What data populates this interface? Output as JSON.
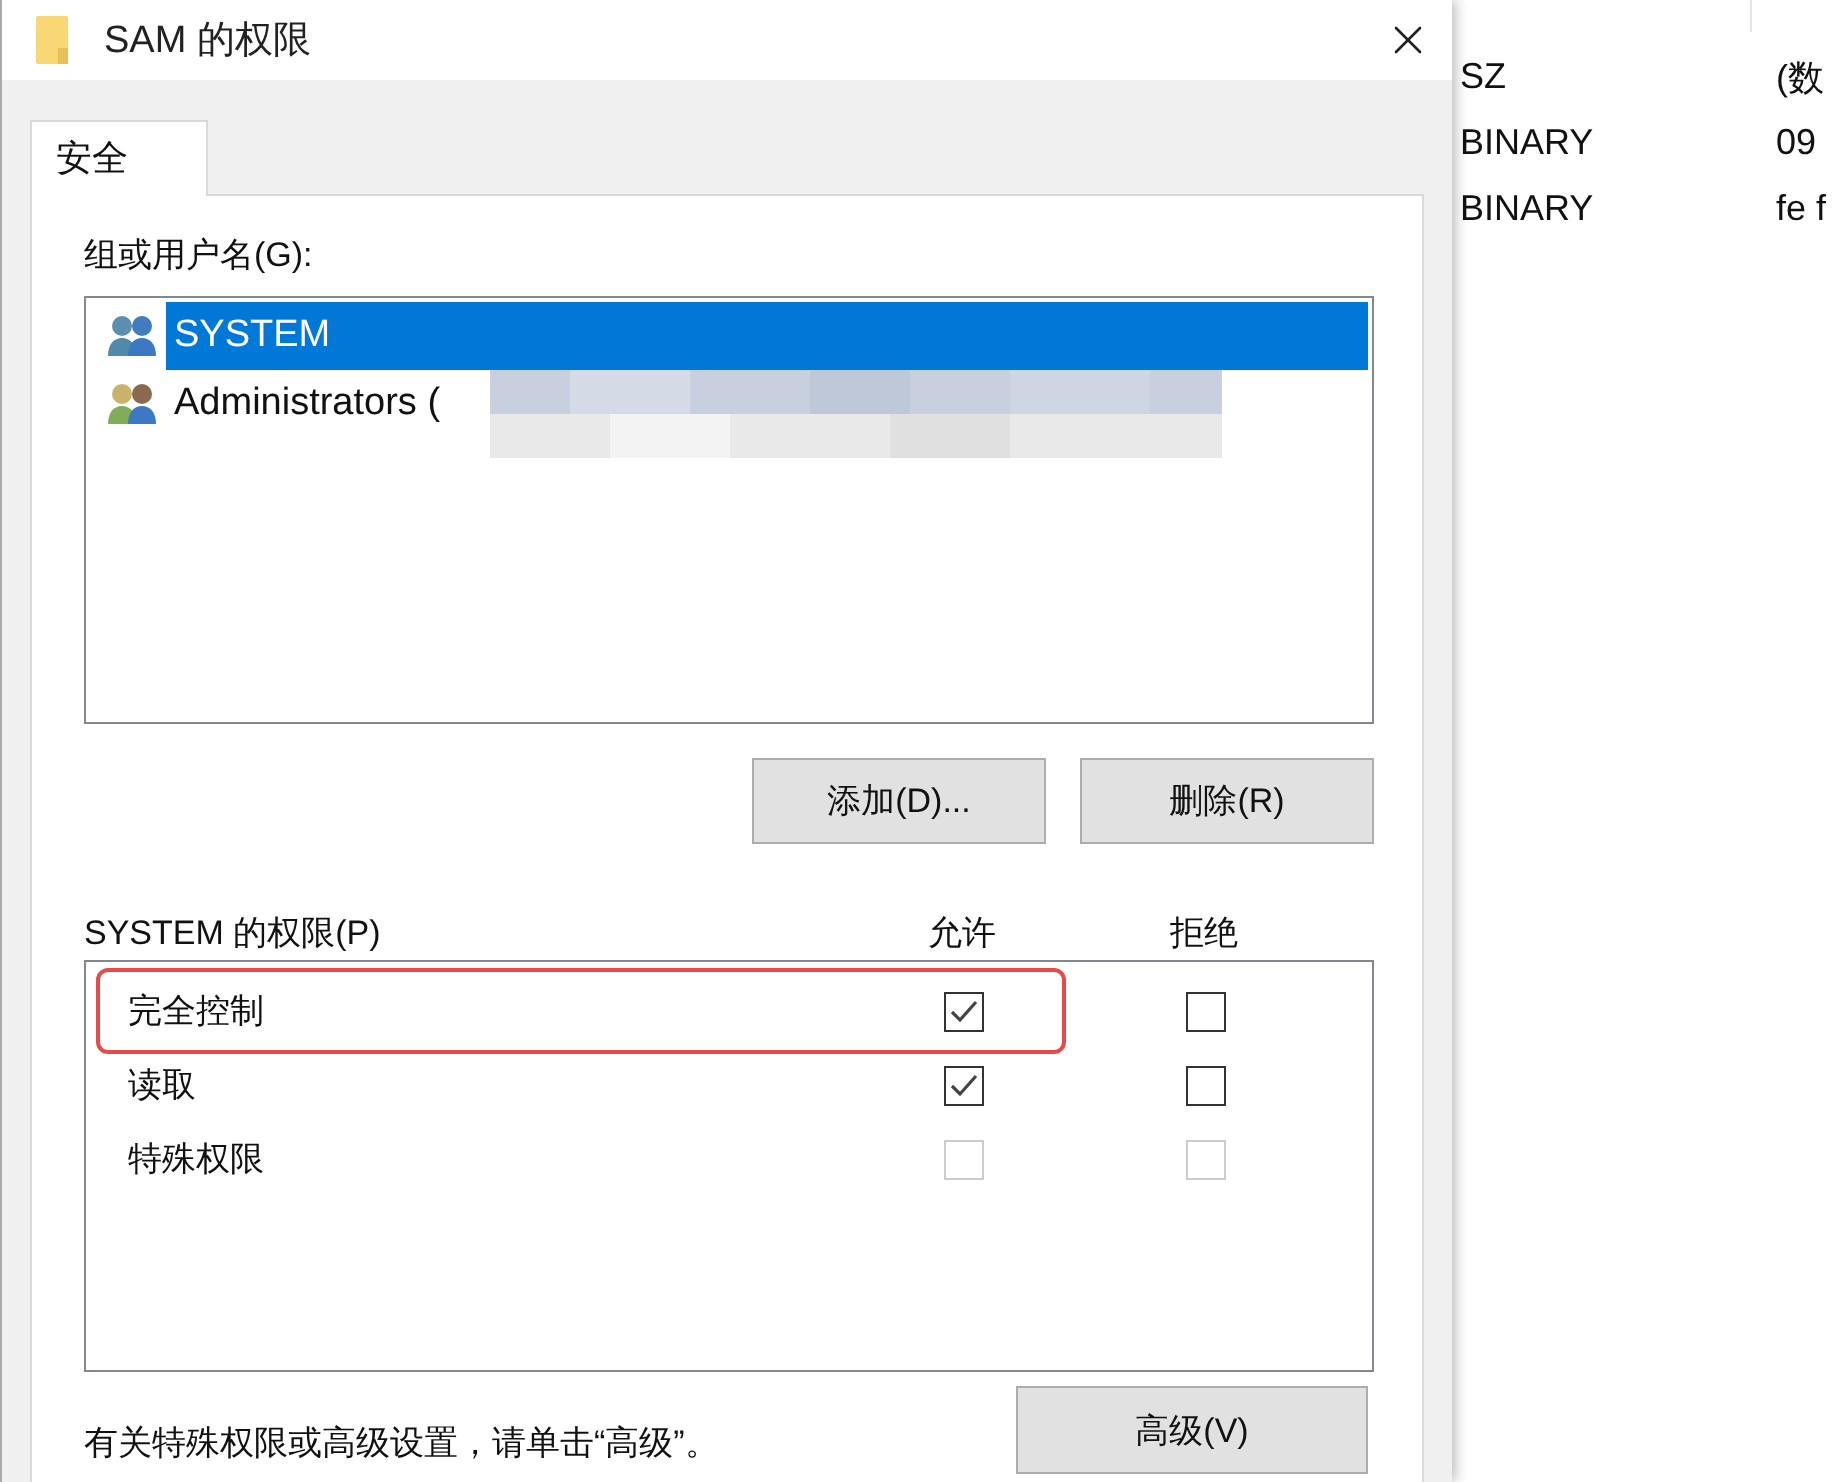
{
  "window": {
    "title": "SAM 的权限"
  },
  "tabs": [
    {
      "label": "安全",
      "selected": true
    }
  ],
  "users": {
    "label": "组或用户名(G):",
    "items": [
      {
        "name": "SYSTEM",
        "selected": true,
        "redacted": false
      },
      {
        "name": "Administrators (",
        "selected": false,
        "redacted": true
      }
    ]
  },
  "buttons": [
    "添加(D)...",
    "删除(R)"
  ],
  "permissions": {
    "label": "SYSTEM 的权限(P)",
    "allow_label": "允许",
    "deny_label": "拒绝",
    "rows": [
      {
        "name": "完全控制",
        "allow": true,
        "deny": false,
        "disabled": false,
        "highlighted": true
      },
      {
        "name": "读取",
        "allow": true,
        "deny": false,
        "disabled": false,
        "highlighted": false
      },
      {
        "name": "特殊权限",
        "allow": false,
        "deny": false,
        "disabled": true,
        "highlighted": false
      }
    ]
  },
  "hint": "有关特殊权限或高级设置，请单击“高级”。",
  "advanced_button": "高级(V)",
  "background_window": {
    "rows": [
      {
        "type": "SZ",
        "value": "(数"
      },
      {
        "type": "BINARY",
        "value": "09"
      },
      {
        "type": "BINARY",
        "value": "fe f"
      }
    ]
  }
}
